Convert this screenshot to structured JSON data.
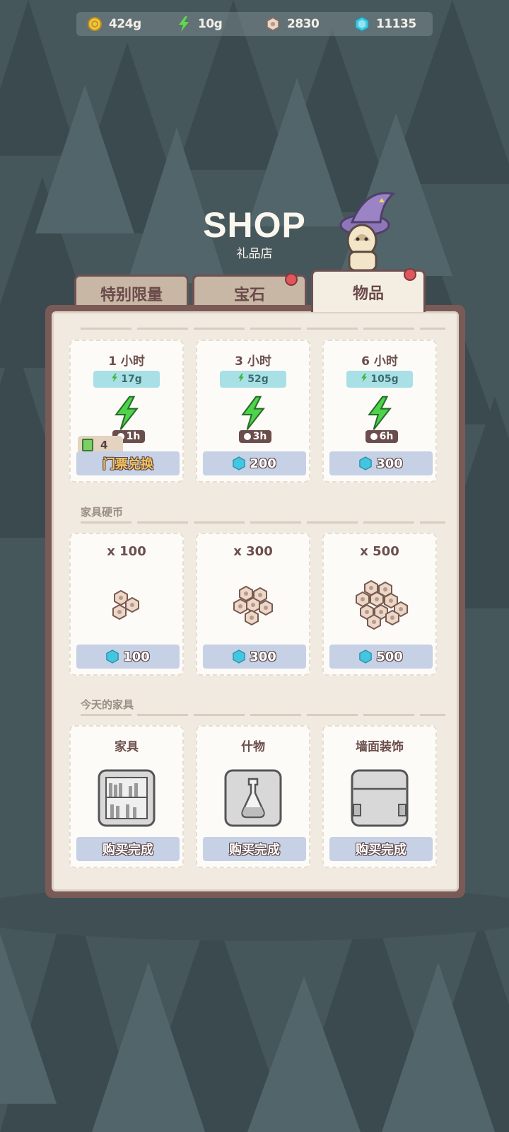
{
  "resources": [
    {
      "icon": "gold-coin-icon",
      "value": "424g"
    },
    {
      "icon": "lightning-icon",
      "value": "10g"
    },
    {
      "icon": "hex-nut-icon",
      "value": "2830"
    },
    {
      "icon": "gem-icon",
      "value": "11135"
    }
  ],
  "header": {
    "title": "SHOP",
    "subtitle": "礼品店"
  },
  "tabs": [
    {
      "label": "特别限量",
      "badge": false
    },
    {
      "label": "宝石",
      "badge": true
    },
    {
      "label": "物品",
      "badge": true,
      "active": true
    }
  ],
  "energy": {
    "items": [
      {
        "title": "1 小时",
        "price": "17g",
        "duration": "1h",
        "button": "门票兑换",
        "tickets": "4"
      },
      {
        "title": "3 小时",
        "price": "52g",
        "duration": "3h",
        "button": "200"
      },
      {
        "title": "6 小时",
        "price": "105g",
        "duration": "6h",
        "button": "300"
      }
    ]
  },
  "coins": {
    "label": "家具硬币",
    "items": [
      {
        "qty": "x 100",
        "button": "100"
      },
      {
        "qty": "x 300",
        "button": "300"
      },
      {
        "qty": "x 500",
        "button": "500"
      }
    ]
  },
  "furniture": {
    "label": "今天的家具",
    "items": [
      {
        "title": "家具",
        "icon": "bookshelf-icon",
        "button": "购买完成"
      },
      {
        "title": "什物",
        "icon": "flask-icon",
        "button": "购买完成"
      },
      {
        "title": "墙面装饰",
        "icon": "wall-panel-icon",
        "button": "购买完成"
      }
    ]
  },
  "colors": {
    "panel": "#7a5a57",
    "card": "#fdfbf8",
    "button": "#c6d1e6",
    "accent_energy": "#4ed44a",
    "gem": "#43c7e0"
  }
}
